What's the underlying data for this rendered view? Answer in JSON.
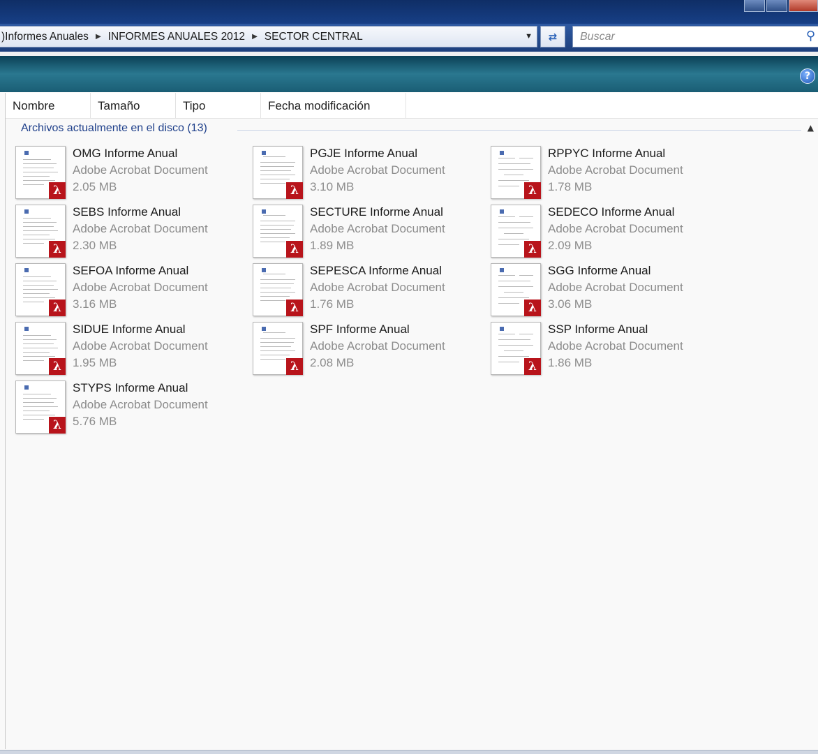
{
  "breadcrumb": {
    "leading": ")",
    "items": [
      "Informes Anuales",
      "INFORMES ANUALES 2012",
      "SECTOR CENTRAL"
    ]
  },
  "search": {
    "placeholder": "Buscar"
  },
  "columns": [
    "Nombre",
    "Tamaño",
    "Tipo",
    "Fecha modificación"
  ],
  "group": {
    "label": "Archivos actualmente en el disco (13)"
  },
  "files": [
    {
      "name": "OMG Informe Anual",
      "type": "Adobe Acrobat Document",
      "size": "2.05 MB"
    },
    {
      "name": "PGJE Informe Anual",
      "type": "Adobe Acrobat Document",
      "size": "3.10 MB"
    },
    {
      "name": "RPPYC Informe Anual",
      "type": "Adobe Acrobat Document",
      "size": "1.78 MB"
    },
    {
      "name": "SEBS Informe Anual",
      "type": "Adobe Acrobat Document",
      "size": "2.30 MB"
    },
    {
      "name": "SECTURE Informe Anual",
      "type": "Adobe Acrobat Document",
      "size": "1.89 MB"
    },
    {
      "name": "SEDECO Informe Anual",
      "type": "Adobe Acrobat Document",
      "size": "2.09 MB"
    },
    {
      "name": "SEFOA Informe Anual",
      "type": "Adobe Acrobat Document",
      "size": "3.16 MB"
    },
    {
      "name": "SEPESCA Informe Anual",
      "type": "Adobe Acrobat Document",
      "size": "1.76 MB"
    },
    {
      "name": "SGG Informe Anual",
      "type": "Adobe Acrobat Document",
      "size": "3.06 MB"
    },
    {
      "name": "SIDUE Informe Anual",
      "type": "Adobe Acrobat Document",
      "size": "1.95 MB"
    },
    {
      "name": "SPF Informe Anual",
      "type": "Adobe Acrobat Document",
      "size": "2.08 MB"
    },
    {
      "name": "SSP Informe Anual",
      "type": "Adobe Acrobat Document",
      "size": "1.86 MB"
    },
    {
      "name": "STYPS Informe Anual",
      "type": "Adobe Acrobat Document",
      "size": "5.76 MB"
    }
  ],
  "icons": {
    "breadcrumb_separator": "chevron-right-icon",
    "dropdown": "chevron-down-icon",
    "refresh": "refresh-icon",
    "search": "search-icon",
    "help": "help-icon",
    "file_badge": "pdf-icon",
    "collapse": "chevron-up-icon"
  },
  "colors": {
    "title_bar": "#173f86",
    "address_bar": "#2f5aa3",
    "toolbar": "#2a7890",
    "group_label": "#1e3f8a",
    "pdf_badge": "#b8141b"
  }
}
